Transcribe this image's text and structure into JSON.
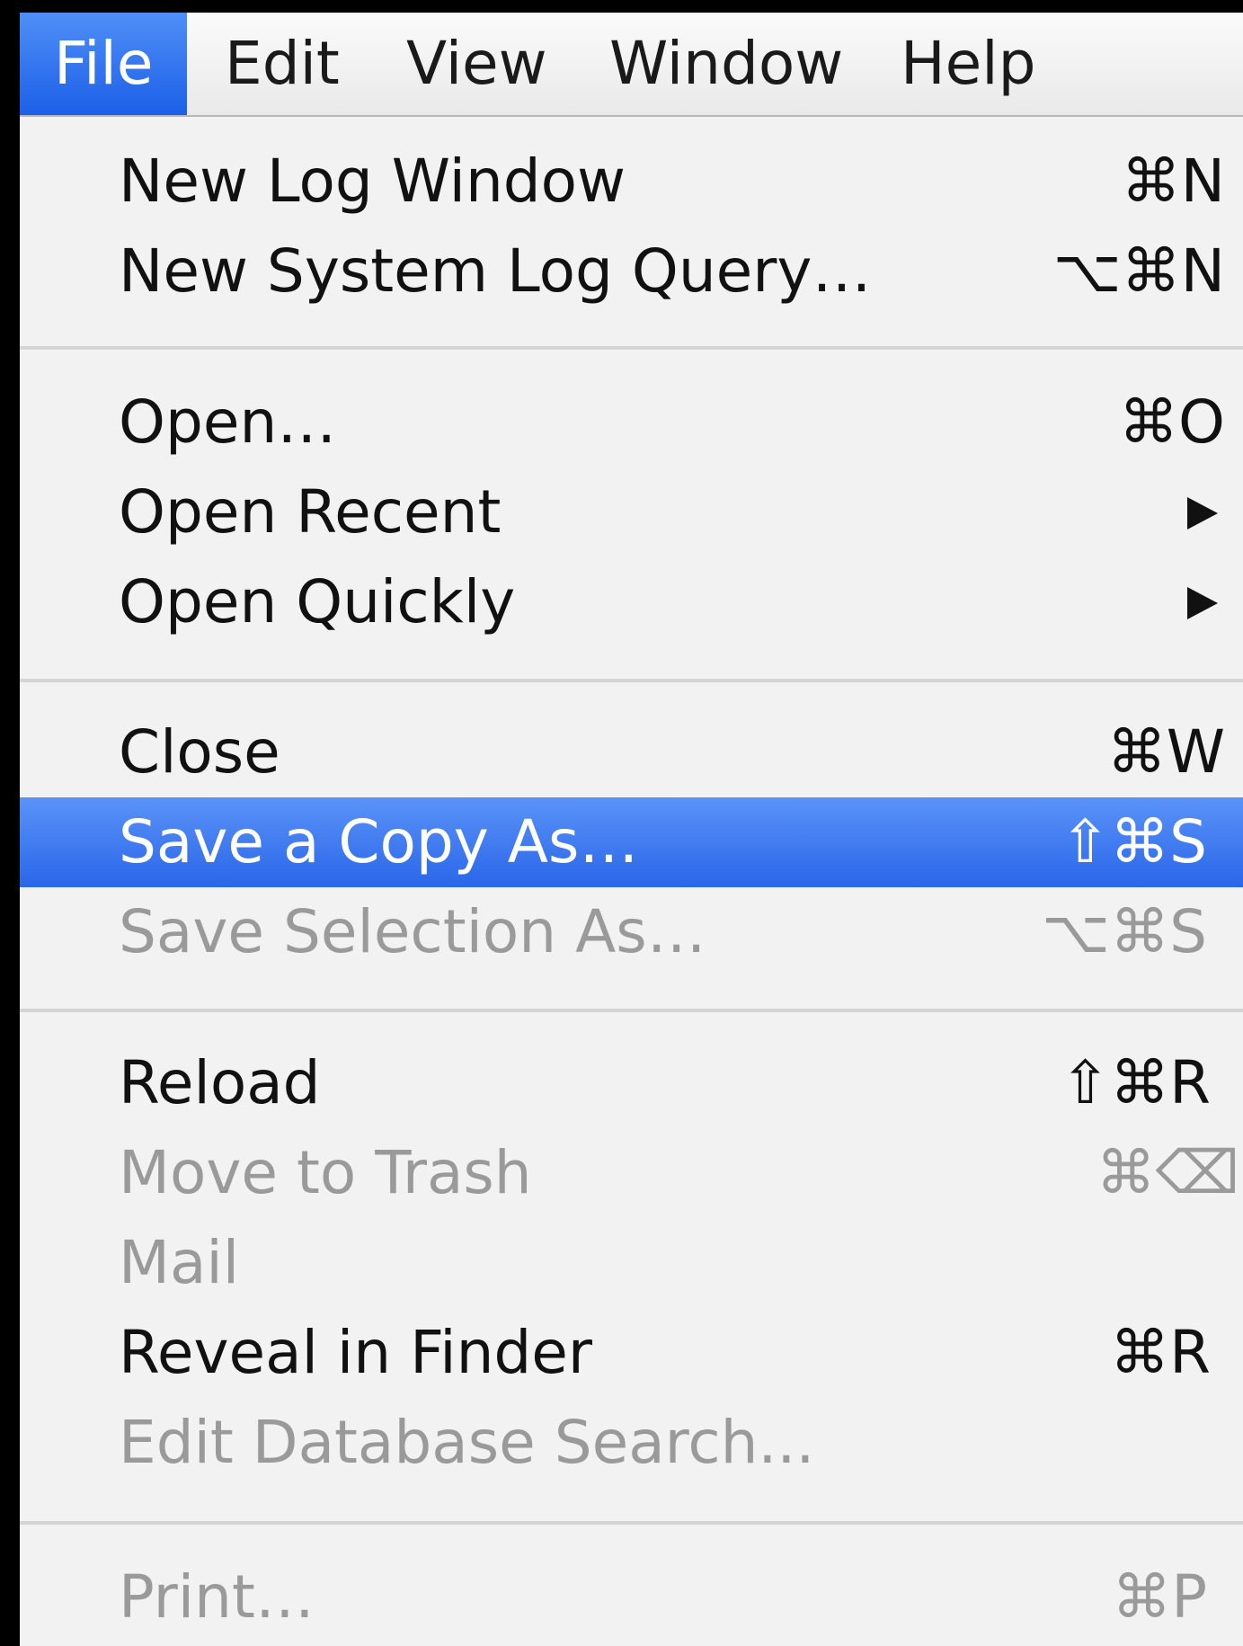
{
  "menubar": {
    "items": [
      {
        "label": "File",
        "active": true
      },
      {
        "label": "Edit",
        "active": false
      },
      {
        "label": "View",
        "active": false
      },
      {
        "label": "Window",
        "active": false
      },
      {
        "label": "Help",
        "active": false
      }
    ]
  },
  "file_menu": {
    "items": [
      {
        "label": "New Log Window",
        "shortcut": "⌘N",
        "enabled": true
      },
      {
        "label": "New System Log Query…",
        "shortcut": "⌥⌘N",
        "enabled": true
      },
      {
        "label": "Open…",
        "shortcut": "⌘O",
        "enabled": true
      },
      {
        "label": "Open Recent",
        "shortcut": "",
        "submenu": true,
        "enabled": true
      },
      {
        "label": "Open Quickly",
        "shortcut": "",
        "submenu": true,
        "enabled": true
      },
      {
        "label": "Close",
        "shortcut": "⌘W",
        "enabled": true
      },
      {
        "label": "Save a Copy As…",
        "shortcut": "⇧⌘S",
        "enabled": true,
        "highlighted": true
      },
      {
        "label": "Save Selection As…",
        "shortcut": "⌥⌘S",
        "enabled": false
      },
      {
        "label": "Reload",
        "shortcut": "⇧⌘R",
        "enabled": true
      },
      {
        "label": "Move to Trash",
        "shortcut": "⌘⌫",
        "enabled": false
      },
      {
        "label": "Mail",
        "shortcut": "",
        "enabled": false
      },
      {
        "label": "Reveal in Finder",
        "shortcut": "⌘R",
        "enabled": true
      },
      {
        "label": "Edit Database Search...",
        "shortcut": "",
        "enabled": false
      },
      {
        "label": "Print…",
        "shortcut": "⌘P",
        "enabled": false
      }
    ]
  },
  "colors": {
    "highlight": "#2a66ea",
    "menu_background": "#f2f2f2",
    "disabled_text": "#9a9a9a"
  }
}
